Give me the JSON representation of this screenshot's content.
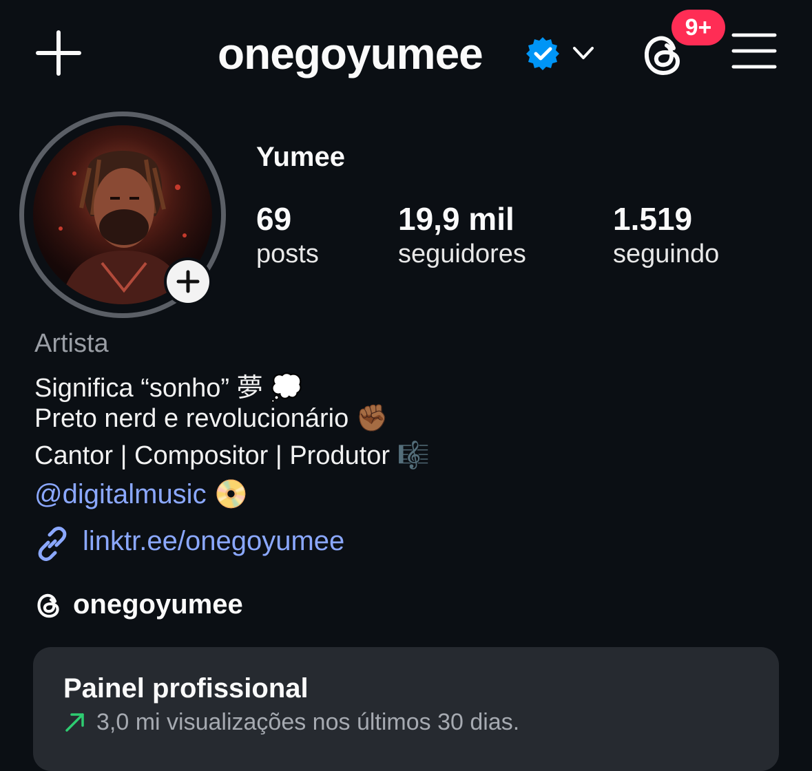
{
  "header": {
    "username": "onegoyumee",
    "notification_badge": "9+",
    "icons": [
      "plus-icon",
      "verified-badge-icon",
      "chevron-down-icon",
      "threads-icon",
      "hamburger-menu-icon"
    ]
  },
  "profile": {
    "display_name": "Yumee",
    "stats": [
      {
        "value": "69",
        "label": "posts"
      },
      {
        "value": "19,9 mil",
        "label": "seguidores"
      },
      {
        "value": "1.519",
        "label": "seguindo"
      }
    ],
    "category": "Artista",
    "bio_lines": [
      "Significa “sonho” 夢 💭",
      "Preto nerd e revolucionário ✊🏾",
      "Cantor | Compositor | Produtor 🎼"
    ],
    "mention": "@digitalmusic",
    "mention_emoji": "📀",
    "link": "linktr.ee/onegoyumee",
    "threads_handle": "onegoyumee"
  },
  "professional_dashboard": {
    "title": "Painel profissional",
    "subtitle": "3,0 mi visualizações nos últimos 30 dias."
  },
  "colors": {
    "background": "#0b0f14",
    "verified_blue": "#0095f6",
    "badge_red": "#ff2d55",
    "link_blue": "#8ba8ff",
    "trend_green": "#2ecc71",
    "card_bg": "#262a30"
  }
}
